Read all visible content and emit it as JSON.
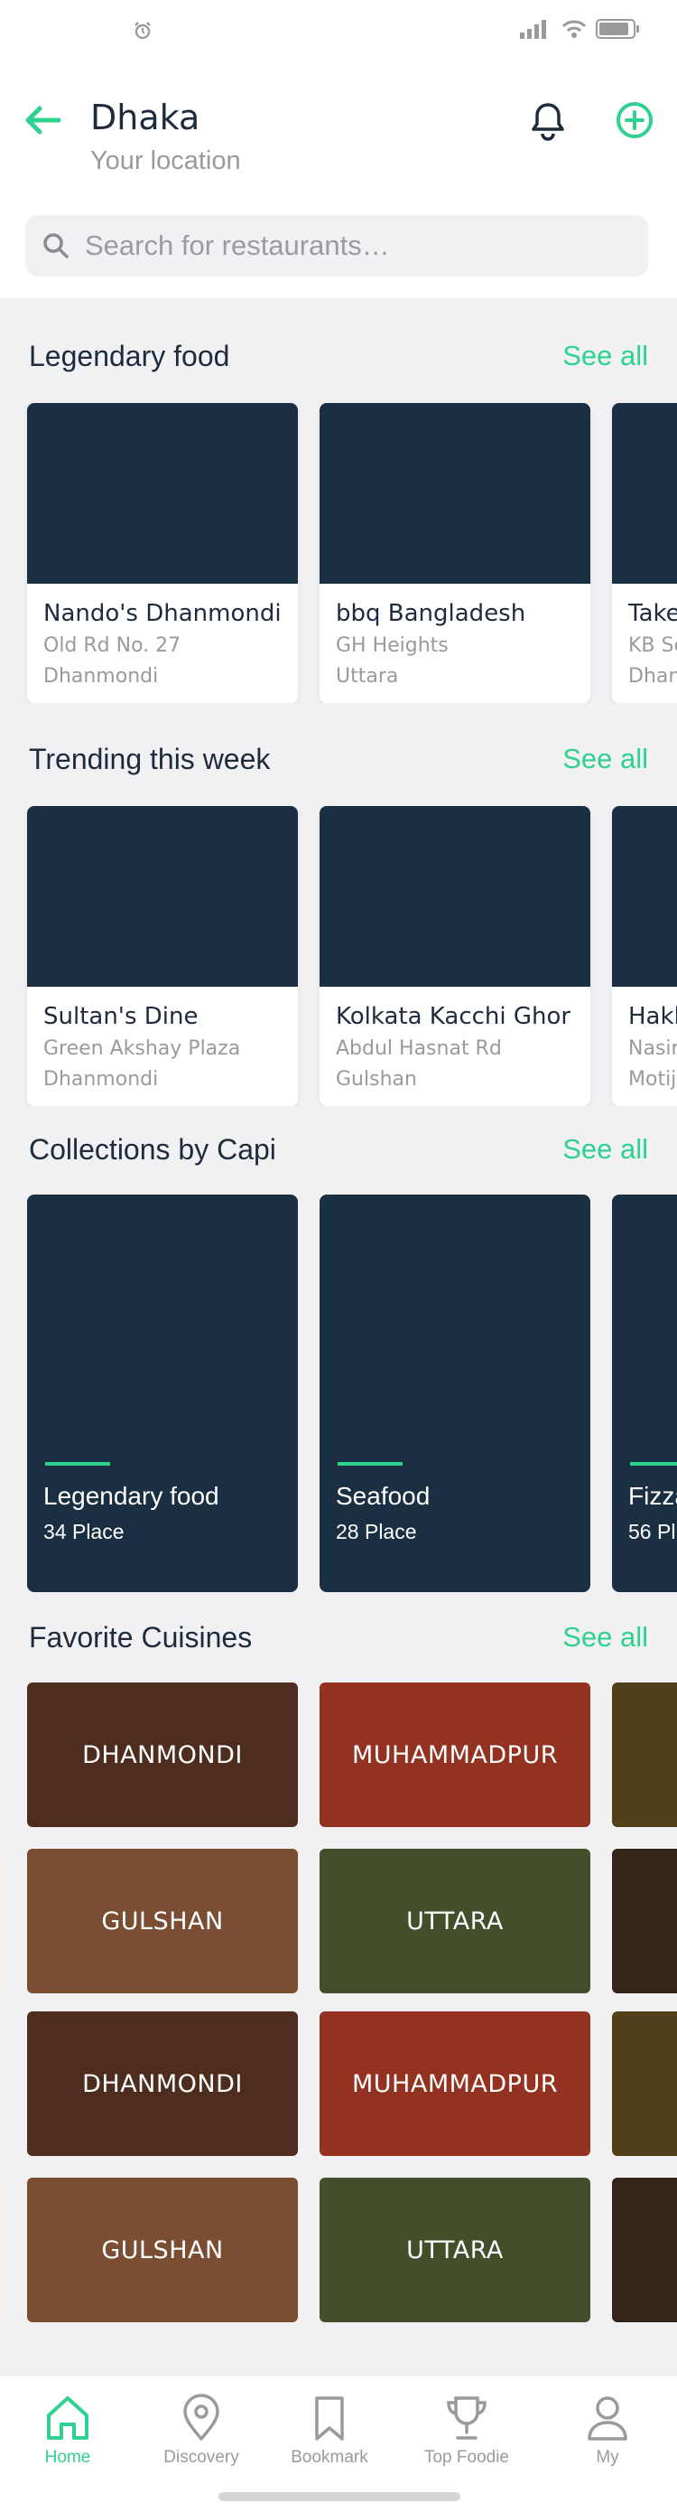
{
  "colors": {
    "accent": "#2ED18E",
    "dark_navy": "#1B2F42",
    "text_dark": "#1E2B3C",
    "muted": "#9A9A9A"
  },
  "status_bar": {
    "icons": [
      "alarm-icon",
      "signal-icon",
      "wifi-icon",
      "battery-icon"
    ]
  },
  "header": {
    "city": "Dhaka",
    "subtitle": "Your location",
    "back_icon": "arrow-left-icon",
    "bell_icon": "bell-icon",
    "add_icon": "plus-circle-icon"
  },
  "search": {
    "placeholder": "Search for restaurants…"
  },
  "sections": {
    "legendary": {
      "title": "Legendary food",
      "see_all": "See all",
      "cards": [
        {
          "name": "Nando's Dhanmondi",
          "address": "Old Rd No. 27",
          "area": "Dhanmondi"
        },
        {
          "name": "bbq Bangladesh",
          "address": "GH Heights",
          "area": "Uttara"
        },
        {
          "name": "Take",
          "address": "KB Sc",
          "area": "Dhan"
        }
      ]
    },
    "trending": {
      "title": "Trending this week",
      "see_all": "See all",
      "cards": [
        {
          "name": "Sultan's Dine",
          "address": "Green Akshay Plaza",
          "area": "Dhanmondi"
        },
        {
          "name": "Kolkata Kacchi Ghor",
          "address": "Abdul Hasnat Rd",
          "area": "Gulshan"
        },
        {
          "name": "Hakl",
          "address": "Nasir",
          "area": "Motij"
        }
      ]
    },
    "collections": {
      "title": "Collections by Capi",
      "see_all": "See all",
      "cards": [
        {
          "title": "Legendary food",
          "count": "34 Place"
        },
        {
          "title": "Seafood",
          "count": "28 Place"
        },
        {
          "title": "Fizza",
          "count": "56 Pl"
        }
      ]
    },
    "cuisines": {
      "title": "Favorite Cuisines",
      "see_all": "See all",
      "rows": [
        [
          {
            "label": "DHANMONDI",
            "color": "#4E2D1E"
          },
          {
            "label": "MUHAMMADPUR",
            "color": "#933220"
          },
          {
            "label": "",
            "color": "#52401C"
          }
        ],
        [
          {
            "label": "GULSHAN",
            "color": "#7B4E33"
          },
          {
            "label": "UTTARA",
            "color": "#434F2A"
          },
          {
            "label": "",
            "color": "#362319"
          }
        ],
        [
          {
            "label": "DHANMONDI",
            "color": "#4E2D1E"
          },
          {
            "label": "MUHAMMADPUR",
            "color": "#933220"
          },
          {
            "label": "",
            "color": "#52401C"
          }
        ],
        [
          {
            "label": "GULSHAN",
            "color": "#7B4E33"
          },
          {
            "label": "UTTARA",
            "color": "#434F2A"
          },
          {
            "label": "",
            "color": "#362319"
          }
        ]
      ]
    }
  },
  "bottom_nav": [
    {
      "label": "Home",
      "icon": "home-icon",
      "active": true
    },
    {
      "label": "Discovery",
      "icon": "map-pin-icon",
      "active": false
    },
    {
      "label": "Bookmark",
      "icon": "bookmark-icon",
      "active": false
    },
    {
      "label": "Top Foodie",
      "icon": "trophy-icon",
      "active": false
    },
    {
      "label": "My",
      "icon": "user-icon",
      "active": false
    }
  ]
}
